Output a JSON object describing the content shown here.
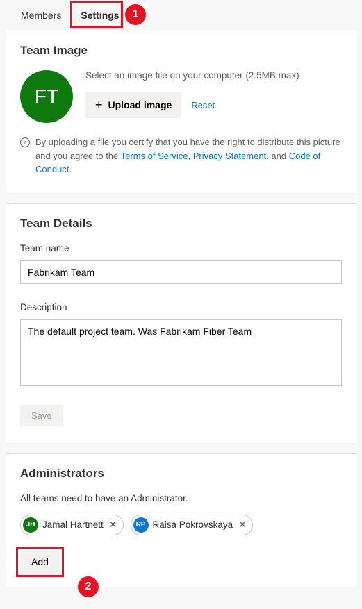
{
  "tabs": {
    "members": "Members",
    "settings": "Settings"
  },
  "callouts": {
    "one": "1",
    "two": "2"
  },
  "teamImage": {
    "title": "Team Image",
    "initials": "FT",
    "help": "Select an image file on your computer (2.5MB max)",
    "uploadLabel": "Upload image",
    "resetLabel": "Reset",
    "disclosurePrefix": "By uploading a file you certify that you have the right to distribute this picture and you agree to the ",
    "tos": "Terms of Service",
    "privacy": "Privacy Statement",
    "coc": "Code of Conduct",
    "sep1": ", ",
    "sep2": ", and ",
    "period": "."
  },
  "teamDetails": {
    "title": "Team Details",
    "nameLabel": "Team name",
    "nameValue": "Fabrikam Team",
    "descLabel": "Description",
    "descValue": "The default project team. Was Fabrikam Fiber Team",
    "saveLabel": "Save"
  },
  "admins": {
    "title": "Administrators",
    "note": "All teams need to have an Administrator.",
    "people": [
      {
        "initials": "JH",
        "name": "Jamal Hartnett",
        "color": "#0e7a0e"
      },
      {
        "initials": "RP",
        "name": "Raisa Pokrovskaya",
        "color": "#0078d4"
      }
    ],
    "addLabel": "Add"
  }
}
